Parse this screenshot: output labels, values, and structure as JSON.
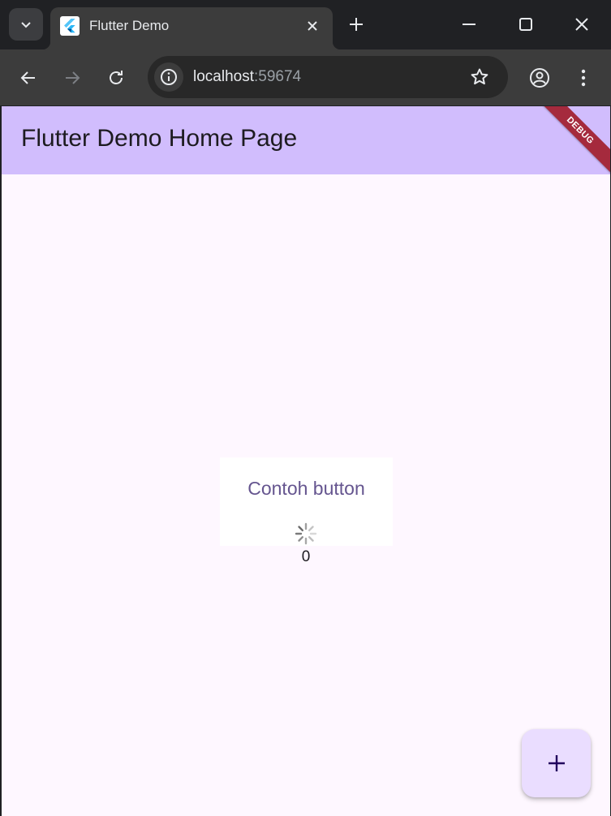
{
  "browser": {
    "tab": {
      "title": "Flutter Demo",
      "favicon": "flutter-logo-icon"
    },
    "address_bar": {
      "host": "localhost",
      "port": ":59674"
    },
    "icons": {
      "tab_search": "chevron-down-icon",
      "close_tab": "close-icon",
      "new_tab": "plus-icon",
      "minimize": "minimize-icon",
      "maximize": "maximize-icon",
      "close_window": "close-icon",
      "back": "back-arrow-icon",
      "forward": "forward-arrow-icon",
      "reload": "reload-icon",
      "site_info": "info-icon",
      "bookmark": "star-icon",
      "profile": "profile-icon",
      "menu": "more-vert-icon"
    }
  },
  "app": {
    "appbar_title": "Flutter Demo Home Page",
    "debug_banner": "DEBUG",
    "button_label": "Contoh button",
    "counter": "0",
    "fab_icon": "plus-icon",
    "colors": {
      "appbar": "#d1bdfd",
      "background": "#fef7ff",
      "button_text": "#65558f",
      "fab": "#eaddff",
      "debug_banner": "#a52a3d"
    }
  }
}
